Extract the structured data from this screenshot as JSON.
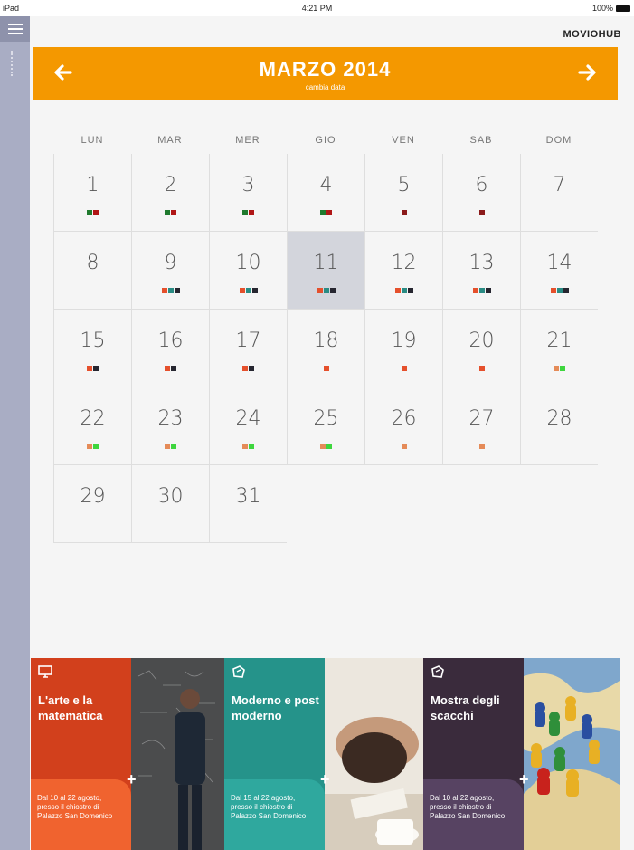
{
  "status": {
    "carrier": "iPad",
    "time": "4:21 PM",
    "battery": "100%"
  },
  "brand": "MOVIOHUB",
  "header": {
    "title": "MARZO 2014",
    "subtitle": "cambia data",
    "prev_icon": "arrow-left-icon",
    "next_icon": "arrow-right-icon",
    "accent": "#f49800"
  },
  "calendar": {
    "weekdays": [
      "LUN",
      "MAR",
      "MER",
      "GIO",
      "VEN",
      "SAB",
      "DOM"
    ],
    "selected_day": "11",
    "weeks": [
      [
        {
          "n": "1",
          "dots": [
            "g",
            "r"
          ]
        },
        {
          "n": "2",
          "dots": [
            "g",
            "r"
          ]
        },
        {
          "n": "3",
          "dots": [
            "g",
            "r"
          ]
        },
        {
          "n": "4",
          "dots": [
            "g",
            "r"
          ]
        },
        {
          "n": "5",
          "dots": [
            "d"
          ]
        },
        {
          "n": "6",
          "dots": [
            "d"
          ]
        },
        {
          "n": "7",
          "dots": []
        }
      ],
      [
        {
          "n": "8",
          "dots": []
        },
        {
          "n": "9",
          "dots": [
            "o",
            "t",
            "k"
          ]
        },
        {
          "n": "10",
          "dots": [
            "o",
            "t",
            "k"
          ]
        },
        {
          "n": "11",
          "dots": [
            "o",
            "t",
            "k"
          ]
        },
        {
          "n": "12",
          "dots": [
            "o",
            "t",
            "k"
          ]
        },
        {
          "n": "13",
          "dots": [
            "o",
            "t",
            "k"
          ]
        },
        {
          "n": "14",
          "dots": [
            "o",
            "t",
            "k"
          ]
        }
      ],
      [
        {
          "n": "15",
          "dots": [
            "o",
            "k"
          ]
        },
        {
          "n": "16",
          "dots": [
            "o",
            "k"
          ]
        },
        {
          "n": "17",
          "dots": [
            "o",
            "k"
          ]
        },
        {
          "n": "18",
          "dots": [
            "o"
          ]
        },
        {
          "n": "19",
          "dots": [
            "o"
          ]
        },
        {
          "n": "20",
          "dots": [
            "o"
          ]
        },
        {
          "n": "21",
          "dots": [
            "a",
            "l"
          ]
        }
      ],
      [
        {
          "n": "22",
          "dots": [
            "a",
            "l"
          ]
        },
        {
          "n": "23",
          "dots": [
            "a",
            "l"
          ]
        },
        {
          "n": "24",
          "dots": [
            "a",
            "l"
          ]
        },
        {
          "n": "25",
          "dots": [
            "a",
            "l"
          ]
        },
        {
          "n": "26",
          "dots": [
            "a"
          ]
        },
        {
          "n": "27",
          "dots": [
            "a"
          ]
        },
        {
          "n": "28",
          "dots": []
        }
      ],
      [
        {
          "n": "29",
          "dots": []
        },
        {
          "n": "30",
          "dots": []
        },
        {
          "n": "31",
          "dots": []
        }
      ]
    ]
  },
  "events": [
    {
      "title": "L'arte e la matematica",
      "desc": "Dal 10 al 22 agosto, presso il chiostro di Palazzo San Domenico",
      "icon": "monitor-icon",
      "color": "#d2401c"
    },
    {
      "title": "Moderno e post moderno",
      "desc": "Dal 15 al 22 agosto, presso il chiostro di Palazzo San Domenico",
      "icon": "tag-icon",
      "color": "#25938a"
    },
    {
      "title": "Mostra degli scacchi",
      "desc": "Dal 10 al 22 agosto, presso il chiostro di Palazzo San Domenico",
      "icon": "tag-icon",
      "color": "#3a2b3c"
    }
  ]
}
